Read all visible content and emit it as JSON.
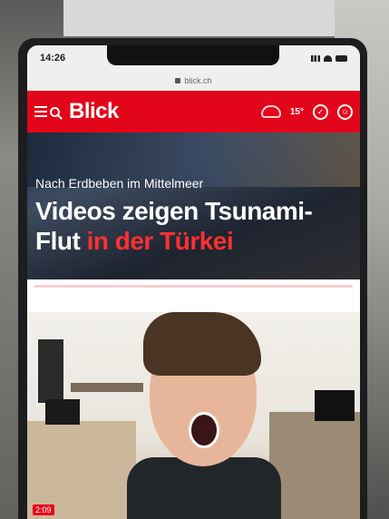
{
  "status_bar": {
    "time": "14:26"
  },
  "browser": {
    "url": "blick.ch"
  },
  "header": {
    "logo": "Blick",
    "temperature": "15°",
    "icons": [
      "menu-icon",
      "search-icon",
      "weather-icon",
      "badge-icon",
      "profile-icon"
    ]
  },
  "hero": {
    "kicker": "Nach Erdbeben im Mittelmeer",
    "headline_white": "Videos zeigen Tsunami-Flut",
    "headline_red": "in der Türkei"
  },
  "photo": {
    "badge": "2:09"
  },
  "colors": {
    "brand_red": "#e3061a",
    "headline_red": "#ff3030"
  }
}
